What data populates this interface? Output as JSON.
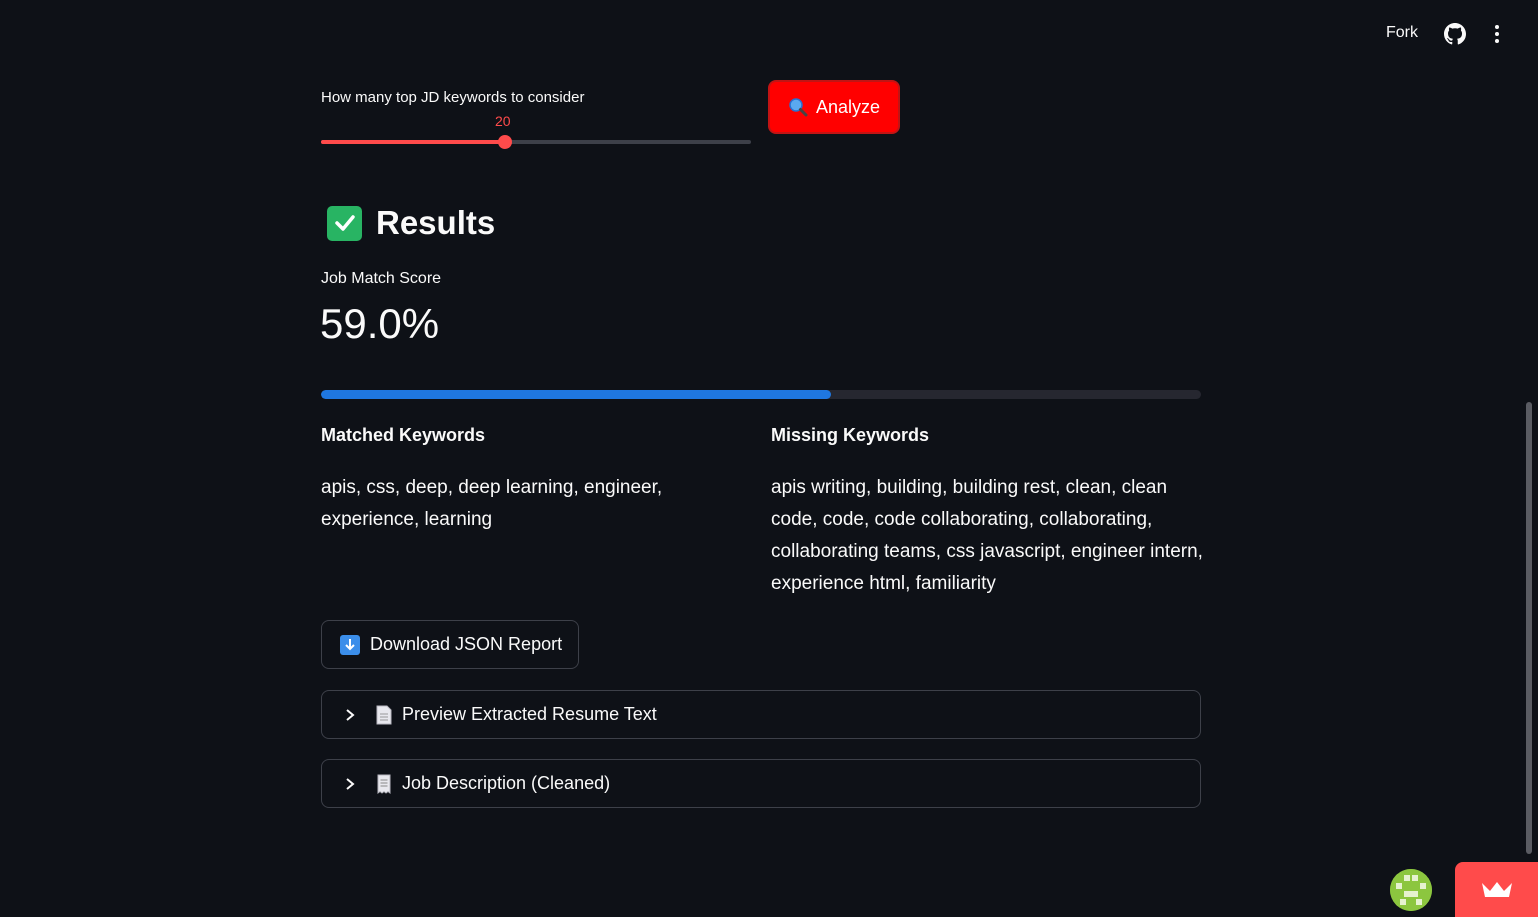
{
  "header": {
    "fork_label": "Fork",
    "github_icon": "github-icon",
    "menu_icon": "kebab-menu-icon"
  },
  "slider": {
    "label": "How many top JD keywords to consider",
    "value": "20",
    "fill_fraction": 0.43,
    "accent": "#ff4b4b"
  },
  "analyze_button": {
    "label": "Analyze",
    "icon": "magnifier-icon",
    "color": "#ff0000"
  },
  "results": {
    "title": "Results",
    "icon": "check-mark-icon",
    "metric_label": "Job Match Score",
    "metric_value": "59.0%",
    "progress_fraction": 0.58,
    "progress_color": "#1f77e0"
  },
  "keywords": {
    "matched_heading": "Matched Keywords",
    "matched_text": "apis, css, deep, deep learning, engineer, experience, learning",
    "missing_heading": "Missing Keywords",
    "missing_text": "apis writing, building, building rest, clean, clean code, code, code collaborating, collaborating, collaborating teams, css javascript, engineer intern, experience html, familiarity"
  },
  "download_button": {
    "label": "Download JSON Report",
    "icon": "download-arrow-icon"
  },
  "expanders": [
    {
      "label": "Preview Extracted Resume Text",
      "icon": "document-icon"
    },
    {
      "label": "Job Description (Cleaned)",
      "icon": "receipt-icon"
    }
  ],
  "colors": {
    "background": "#0e1117",
    "text": "#fafafa",
    "border": "#3d4049"
  }
}
